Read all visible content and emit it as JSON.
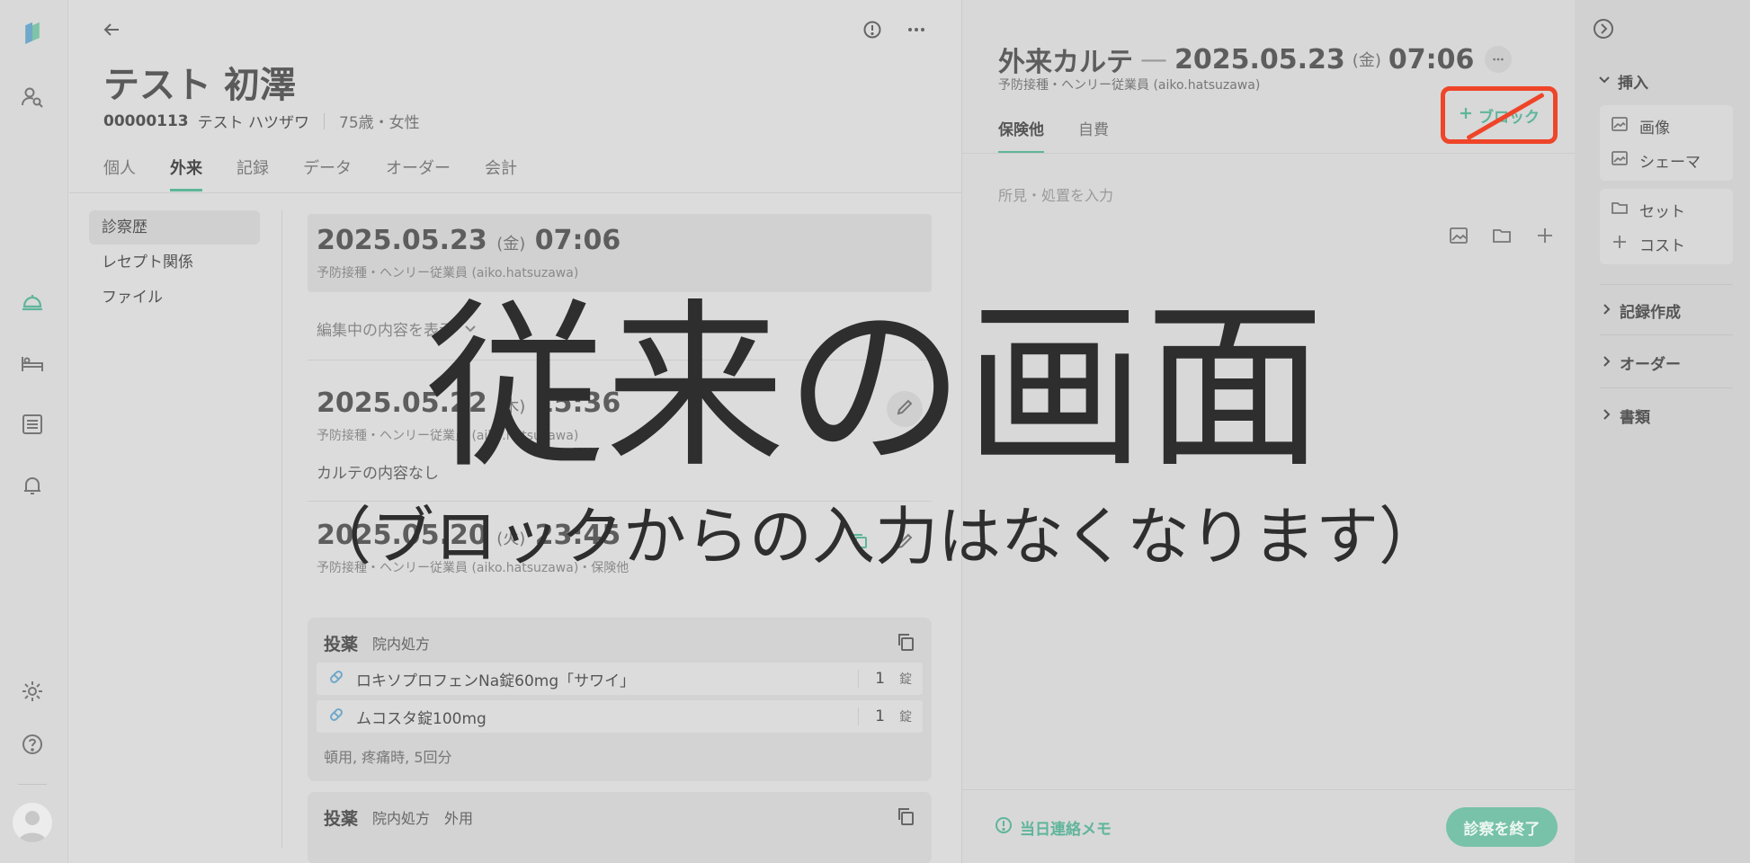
{
  "patient": {
    "name": "テスト 初澤",
    "id": "00000113",
    "kana": "テスト ハツザワ",
    "age_sex": "75歳・女性",
    "tabs": [
      {
        "label": "個人",
        "active": false
      },
      {
        "label": "外来",
        "active": true
      },
      {
        "label": "記録",
        "active": false
      },
      {
        "label": "データ",
        "active": false
      },
      {
        "label": "オーダー",
        "active": false
      },
      {
        "label": "会計",
        "active": false
      }
    ],
    "subnav": [
      {
        "label": "診察歴",
        "active": true
      },
      {
        "label": "レセプト関係",
        "active": false
      },
      {
        "label": "ファイル",
        "active": false
      }
    ]
  },
  "history": {
    "current": {
      "date": "2025.05.23",
      "dow": "(金)",
      "time": "07:06",
      "meta": "予防接種・ヘンリー従業員 (aiko.hatsuzawa)"
    },
    "edit_toggle": "編集中の内容を表示",
    "visits": [
      {
        "date": "2025.05.22",
        "dow": "(木)",
        "time": "15:36",
        "meta": "予防接種・ヘンリー従業員 (aiko.hatsuzawa)",
        "note": "カルテの内容なし"
      },
      {
        "date": "2025.05.20",
        "dow": "(火)",
        "time": "23:45",
        "meta": "予防接種・ヘンリー従業員 (aiko.hatsuzawa)・保険他"
      }
    ],
    "med_cards": [
      {
        "category": "投薬",
        "type": "院内処方",
        "extra": "",
        "rows": [
          {
            "name": "ロキソプロフェンNa錠60mg「サワイ」",
            "qty": "1",
            "unit": "錠"
          },
          {
            "name": "ムコスタ錠100mg",
            "qty": "1",
            "unit": "錠"
          }
        ],
        "usage": "頓用, 疼痛時, 5回分"
      },
      {
        "category": "投薬",
        "type": "院内処方",
        "extra": "外用"
      }
    ]
  },
  "karte": {
    "title": "外来カルテ",
    "dash": "—",
    "date": "2025.05.23",
    "dow": "(金)",
    "time": "07:06",
    "meta": "予防接種・ヘンリー従業員 (aiko.hatsuzawa)",
    "tabs": [
      {
        "label": "保険他",
        "active": true
      },
      {
        "label": "自費",
        "active": false
      }
    ],
    "block_button": "ブロック",
    "input_placeholder": "所見・処置を入力",
    "memo": "当日連絡メモ",
    "finish_button": "診察を終了"
  },
  "insert_panel": {
    "insert_title": "挿入",
    "group1": [
      {
        "label": "画像",
        "icon": "image-icon"
      },
      {
        "label": "シェーマ",
        "icon": "image-icon"
      }
    ],
    "group2": [
      {
        "label": "セット",
        "icon": "folder-icon"
      },
      {
        "label": "コスト",
        "icon": "plus-icon"
      }
    ],
    "sections": [
      "記録作成",
      "オーダー",
      "書類"
    ]
  },
  "overlay": {
    "title": "従来の画面",
    "subtitle": "（ブロックからの入力はなくなります）"
  },
  "colors": {
    "accent": "#5fb59a",
    "highlight": "#ee4529"
  }
}
